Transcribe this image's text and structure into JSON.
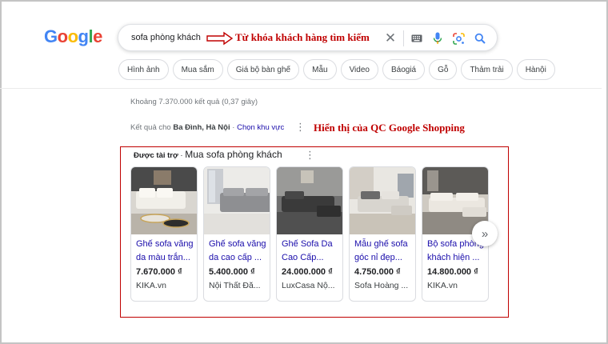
{
  "logo": {
    "letters": [
      "G",
      "o",
      "o",
      "g",
      "l",
      "e"
    ],
    "colors": [
      "#4285F4",
      "#EA4335",
      "#FBBC05",
      "#4285F4",
      "#34A853",
      "#EA4335"
    ]
  },
  "search": {
    "query": "sofa phòng khách"
  },
  "annotations": {
    "keyword": "Từ khóa khách hàng tìm kiếm",
    "shopping": "Hiển thị của QC Google Shopping",
    "color": "#c00000"
  },
  "filters": [
    "Hình ảnh",
    "Mua sắm",
    "Giá bộ bàn ghế",
    "Mẫu",
    "Video",
    "Báogiá",
    "Gỗ",
    "Thảm trải",
    "Hànội"
  ],
  "result_stats": "Khoảng 7.370.000 kết quả (0,37 giây)",
  "location": {
    "prefix": "Kết quả cho",
    "place": "Ba Đình, Hà Nội",
    "separator": "·",
    "link": "Chọn khu vực"
  },
  "shopping": {
    "sponsored": "Được tài trợ",
    "separator": "·",
    "title": "Mua sofa phòng khách",
    "products": [
      {
        "title": "Ghế sofa văng da màu trắn...",
        "price": "7.670.000 ₫",
        "store": "KIKA.vn"
      },
      {
        "title": "Ghế sofa văng da cao cấp ...",
        "price": "5.400.000 ₫",
        "store": "Nội Thất Đă..."
      },
      {
        "title": "Ghế Sofa Da Cao Cấp...",
        "price": "24.000.000 ₫",
        "store": "LuxCasa Nộ..."
      },
      {
        "title": "Mẫu ghế sofa góc nỉ đẹp...",
        "price": "4.750.000 ₫",
        "store": "Sofa Hoàng ..."
      },
      {
        "title": "Bộ sofa phòng khách hiện ...",
        "price": "14.800.000 ₫",
        "store": "KIKA.vn"
      }
    ]
  },
  "icons": {
    "clear": "close-icon",
    "keyboard": "keyboard-icon",
    "mic": "mic-icon",
    "lens": "lens-icon",
    "search": "search-icon",
    "next": "chevron-double-right-icon",
    "more": "more-vert-icon"
  }
}
